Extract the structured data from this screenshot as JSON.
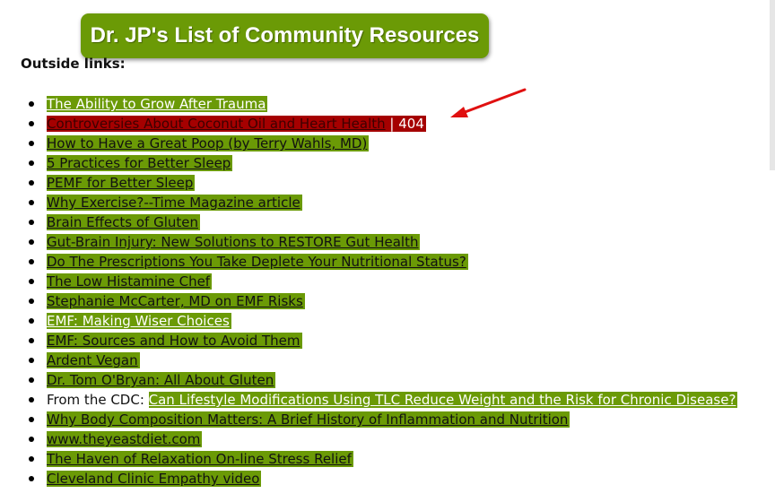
{
  "page": {
    "title": "Dr. JP's List of Community Resources",
    "section_label": "Outside links:"
  },
  "links": [
    {
      "text": "The Ability to Grow After Trauma",
      "style": "green-white"
    },
    {
      "text": "Controversies About Coconut Oil and Heart Health",
      "style": "broken",
      "separator": "|",
      "status": "404"
    },
    {
      "text": "How to Have a Great Poop (by Terry Wahls, MD)",
      "style": "green"
    },
    {
      "text": "5 Practices for Better Sleep",
      "style": "green"
    },
    {
      "text": "PEMF for Better Sleep",
      "style": "green"
    },
    {
      "text": "Why Exercise?--Time Magazine article",
      "style": "green"
    },
    {
      "text": "Brain Effects of Gluten",
      "style": "green"
    },
    {
      "text": "Gut-Brain Injury: New Solutions to RESTORE Gut Health",
      "style": "green"
    },
    {
      "text": "Do The Prescriptions You Take Deplete Your Nutritional Status?",
      "style": "green"
    },
    {
      "text": "The Low Histamine Chef",
      "style": "green"
    },
    {
      "text": "Stephanie McCarter, MD on EMF Risks",
      "style": "green"
    },
    {
      "text": "EMF: Making Wiser Choices",
      "style": "green-white"
    },
    {
      "text": "EMF: Sources and How to Avoid Them",
      "style": "green"
    },
    {
      "text": "Ardent Vegan",
      "style": "green"
    },
    {
      "text": "Dr. Tom O'Bryan: All About Gluten",
      "style": "green"
    },
    {
      "text": "Can Lifestyle Modifications Using TLC Reduce Weight and the Risk for Chronic Disease?",
      "style": "green-white",
      "prefix": "From the CDC: "
    },
    {
      "text": "Why Body Composition Matters: A Brief History of Inflammation and Nutrition",
      "style": "green"
    },
    {
      "text": "www.theyeastdiet.com",
      "style": "green"
    },
    {
      "text": "The Haven of Relaxation On-line Stress Relief",
      "style": "green"
    },
    {
      "text": "Cleveland Clinic Empathy video",
      "style": "green"
    }
  ],
  "colors": {
    "accent_green": "#6b9a06",
    "broken_red": "#a50000",
    "annotation_arrow": "#e01010"
  },
  "icons": {
    "bullet": "bullet-dot-icon",
    "annotation": "red-arrow-icon"
  }
}
